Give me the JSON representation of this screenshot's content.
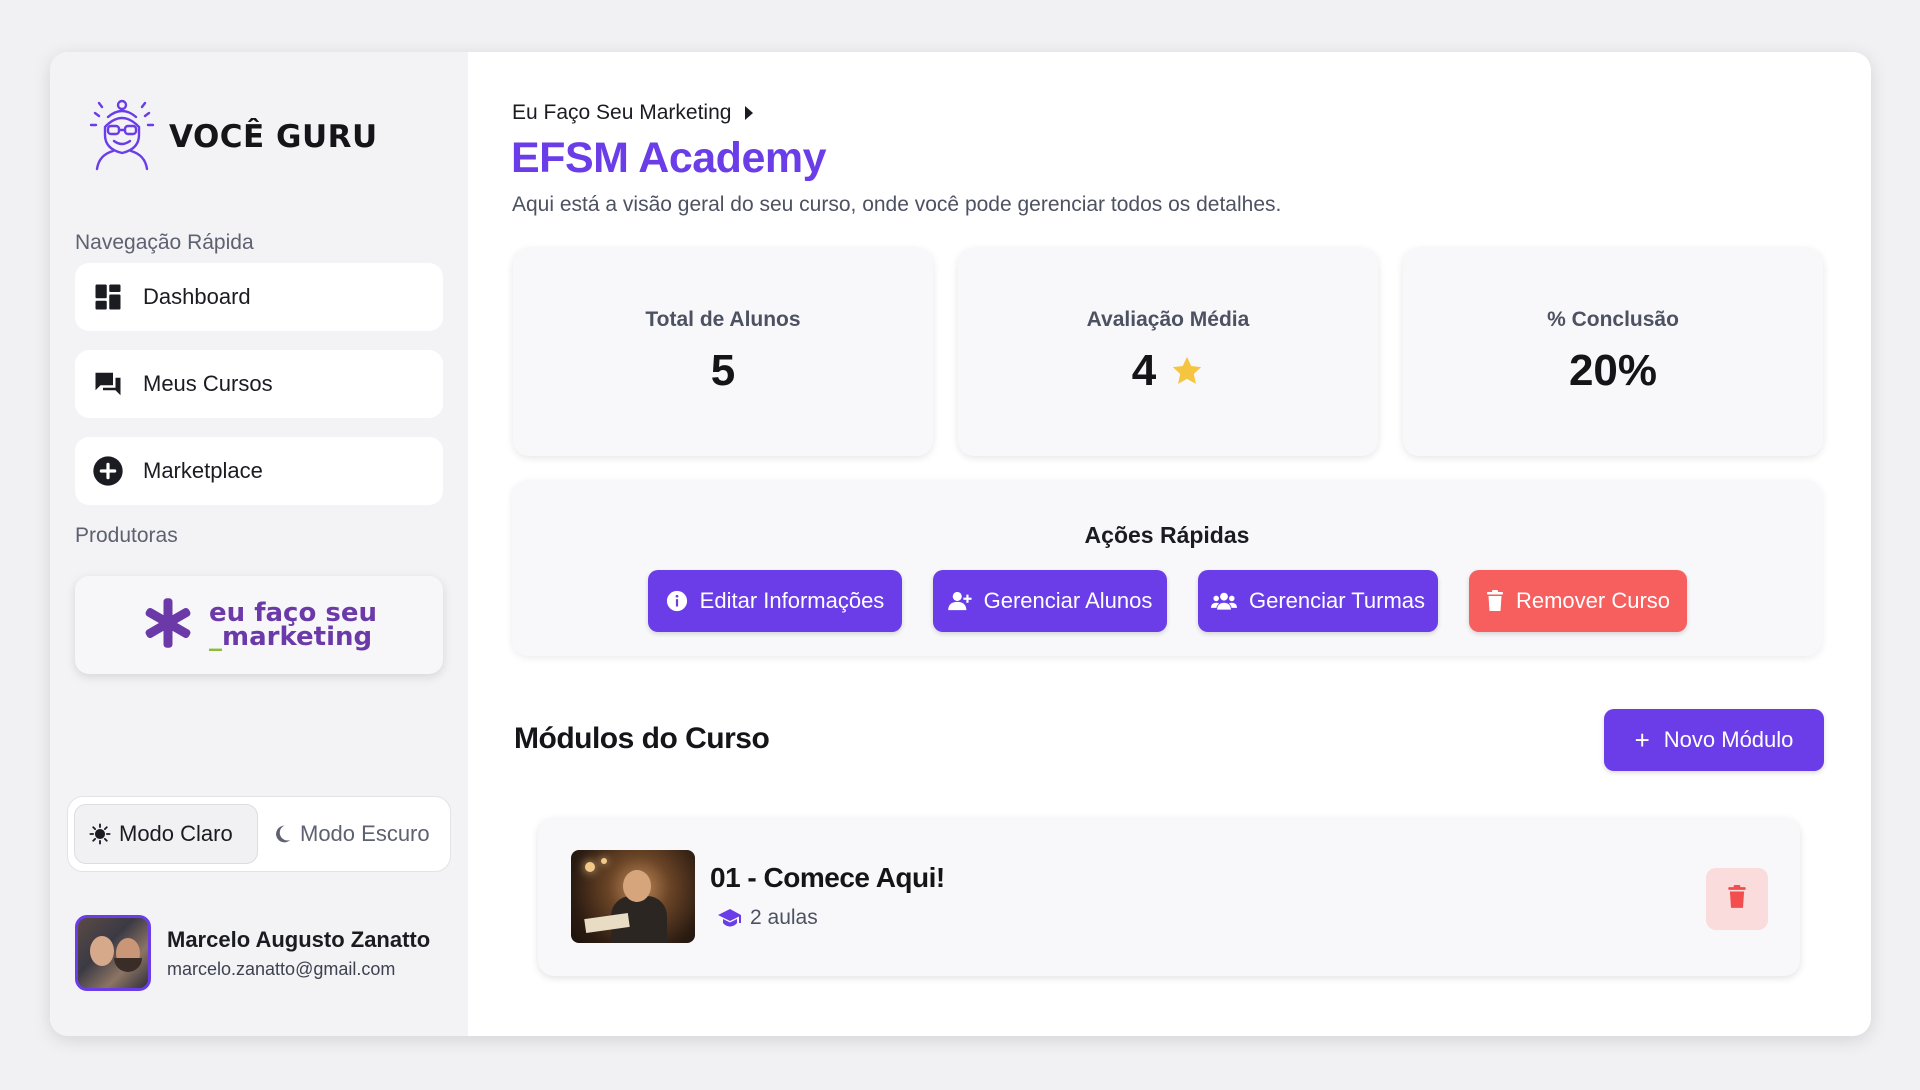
{
  "brand": {
    "name": "VOCÊ GURU"
  },
  "sidebar": {
    "nav_label": "Navegação Rápida",
    "items": [
      {
        "label": "Dashboard",
        "icon": "dashboard-icon"
      },
      {
        "label": "Meus Cursos",
        "icon": "chat-bubbles-icon"
      },
      {
        "label": "Marketplace",
        "icon": "plus-circle-icon"
      }
    ],
    "producers_label": "Produtoras",
    "producer": {
      "line1": "eu faço seu",
      "line2_prefix": "_",
      "line2": "marketing"
    },
    "theme": {
      "light": "Modo Claro",
      "dark": "Modo Escuro",
      "active": "light"
    },
    "user": {
      "name": "Marcelo Augusto Zanatto",
      "email": "marcelo.zanatto@gmail.com"
    }
  },
  "main": {
    "breadcrumb": "Eu Faço Seu Marketing",
    "title": "EFSM Academy",
    "subtitle": "Aqui está a visão geral do seu curso, onde você pode gerenciar todos os detalhes.",
    "stats": [
      {
        "label": "Total de Alunos",
        "value": "5"
      },
      {
        "label": "Avaliação Média",
        "value": "4",
        "icon": "star-icon"
      },
      {
        "label": "% Conclusão",
        "value": "20%"
      }
    ],
    "actions": {
      "title": "Ações Rápidas",
      "buttons": [
        {
          "label": "Editar Informações",
          "icon": "info-icon"
        },
        {
          "label": "Gerenciar Alunos",
          "icon": "user-plus-icon"
        },
        {
          "label": "Gerenciar Turmas",
          "icon": "users-group-icon"
        },
        {
          "label": "Remover Curso",
          "icon": "trash-icon"
        }
      ]
    },
    "modules_title": "Módulos do Curso",
    "new_module_label": "Novo Módulo",
    "modules": [
      {
        "title": "01 - Comece Aqui!",
        "lessons": "2 aulas"
      }
    ]
  },
  "colors": {
    "accent": "#6a3de8",
    "danger": "#f75e5e",
    "star": "#f5c542"
  }
}
